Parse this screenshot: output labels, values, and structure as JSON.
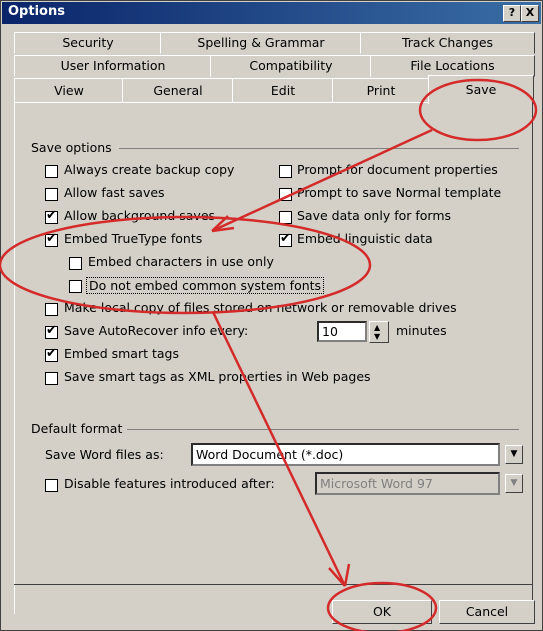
{
  "window": {
    "title": "Options",
    "help_glyph": "?",
    "close_glyph": "X"
  },
  "tabs_row1": [
    "Security",
    "Spelling & Grammar",
    "Track Changes"
  ],
  "tabs_row2": [
    "User Information",
    "Compatibility",
    "File Locations"
  ],
  "tabs_row3": [
    "View",
    "General",
    "Edit",
    "Print",
    "Save"
  ],
  "active_tab": "Save",
  "save_options": {
    "group_label": "Save options",
    "always_backup": {
      "label": "Always create backup copy",
      "checked": false
    },
    "prompt_doc_props": {
      "label": "Prompt for document properties",
      "checked": false
    },
    "allow_fast_saves": {
      "label": "Allow fast saves",
      "checked": false
    },
    "prompt_normal": {
      "label": "Prompt to save Normal template",
      "checked": false
    },
    "allow_background": {
      "label": "Allow background saves",
      "checked": true
    },
    "save_data_forms": {
      "label": "Save data only for forms",
      "checked": false
    },
    "embed_truetype": {
      "label": "Embed TrueType fonts",
      "checked": true
    },
    "embed_linguistic": {
      "label": "Embed linguistic data",
      "checked": true
    },
    "embed_chars_in_use": {
      "label": "Embed characters in use only",
      "checked": false
    },
    "no_embed_common": {
      "label": "Do not embed common system fonts",
      "checked": false
    },
    "local_copy": {
      "label": "Make local copy of files stored on network or removable drives",
      "checked": false
    },
    "autorecover": {
      "label": "Save AutoRecover info every:",
      "checked": true,
      "value": "10",
      "unit": "minutes"
    },
    "smart_tags": {
      "label": "Embed smart tags",
      "checked": true
    },
    "smart_tags_xml": {
      "label": "Save smart tags as XML properties in Web pages",
      "checked": false
    }
  },
  "default_format": {
    "group_label": "Default format",
    "save_as_label": "Save Word files as:",
    "save_as_value": "Word Document (*.doc)",
    "disable_label": "Disable features introduced after:",
    "disable_checked": false,
    "disable_value": "Microsoft Word 97"
  },
  "buttons": {
    "ok": "OK",
    "cancel": "Cancel"
  },
  "colors": {
    "annotation": "#d42a2a",
    "titlebar": "#0a246a",
    "dialog": "#d4d0c8"
  }
}
